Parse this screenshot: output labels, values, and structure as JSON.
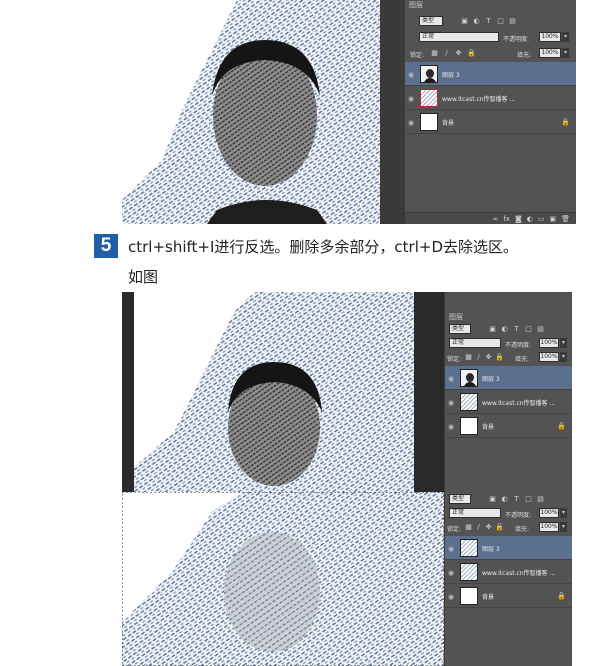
{
  "step": {
    "number": "5",
    "instruction": "ctrl+shift+I进行反选。删除多余部分，ctrl+D去除选区。",
    "caption": "如图"
  },
  "panel": {
    "tab": "图层",
    "kind_filter": "类型",
    "blend_mode": "正常",
    "opacity_label": "不透明度:",
    "opacity_value": "100%",
    "lock_label": "锁定:",
    "fill_label": "填充:",
    "fill_value": "100%",
    "layers": [
      {
        "name": "图层 3",
        "selected": true
      },
      {
        "name": "www.itcast.cn传智播客 ...",
        "selected": false
      },
      {
        "name": "背景",
        "selected": false,
        "locked": true
      }
    ]
  },
  "colors": {
    "panel_bg": "#535353",
    "selected_layer": "#5b6f8f",
    "step_badge": "#1f5fa6",
    "halftone": "#3e5577"
  },
  "icons": [
    "eye-icon",
    "lock-icon",
    "link-icon",
    "fx-icon",
    "mask-icon",
    "adjustment-icon",
    "folder-icon",
    "new-layer-icon",
    "trash-icon"
  ]
}
